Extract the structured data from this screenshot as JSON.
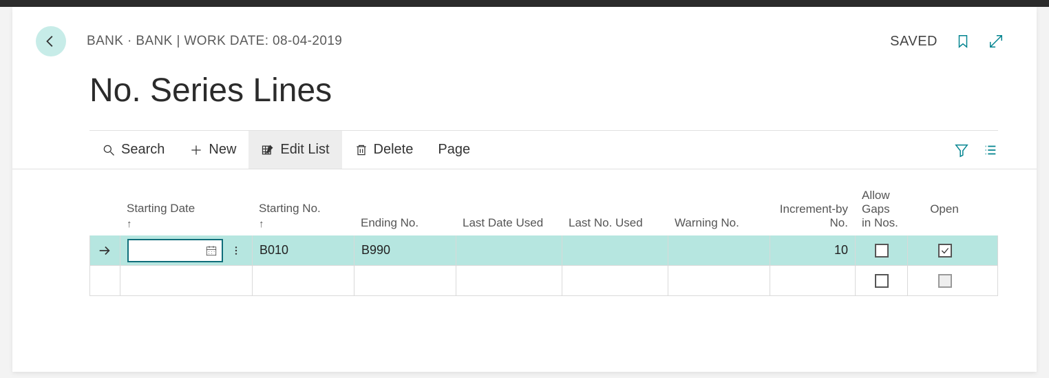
{
  "header": {
    "breadcrumb": "BANK · BANK | WORK DATE: 08-04-2019",
    "page_title": "No. Series Lines",
    "saved_label": "SAVED"
  },
  "toolbar": {
    "search": "Search",
    "new": "New",
    "edit_list": "Edit List",
    "delete": "Delete",
    "page": "Page"
  },
  "columns": {
    "starting_date": "Starting Date",
    "starting_no": "Starting No.",
    "ending_no": "Ending No.",
    "last_date_used": "Last Date Used",
    "last_no_used": "Last No. Used",
    "warning_no": "Warning No.",
    "increment_by": "Increment-by No.",
    "allow_gaps": "Allow Gaps in Nos.",
    "open": "Open"
  },
  "rows": [
    {
      "selected": true,
      "starting_date": "",
      "starting_no": "B010",
      "ending_no": "B990",
      "last_date_used": "",
      "last_no_used": "",
      "warning_no": "",
      "increment_by": "10",
      "allow_gaps": false,
      "open": true
    },
    {
      "selected": false,
      "starting_date": "",
      "starting_no": "",
      "ending_no": "",
      "last_date_used": "",
      "last_no_used": "",
      "warning_no": "",
      "increment_by": "",
      "allow_gaps": false,
      "open": false
    }
  ]
}
